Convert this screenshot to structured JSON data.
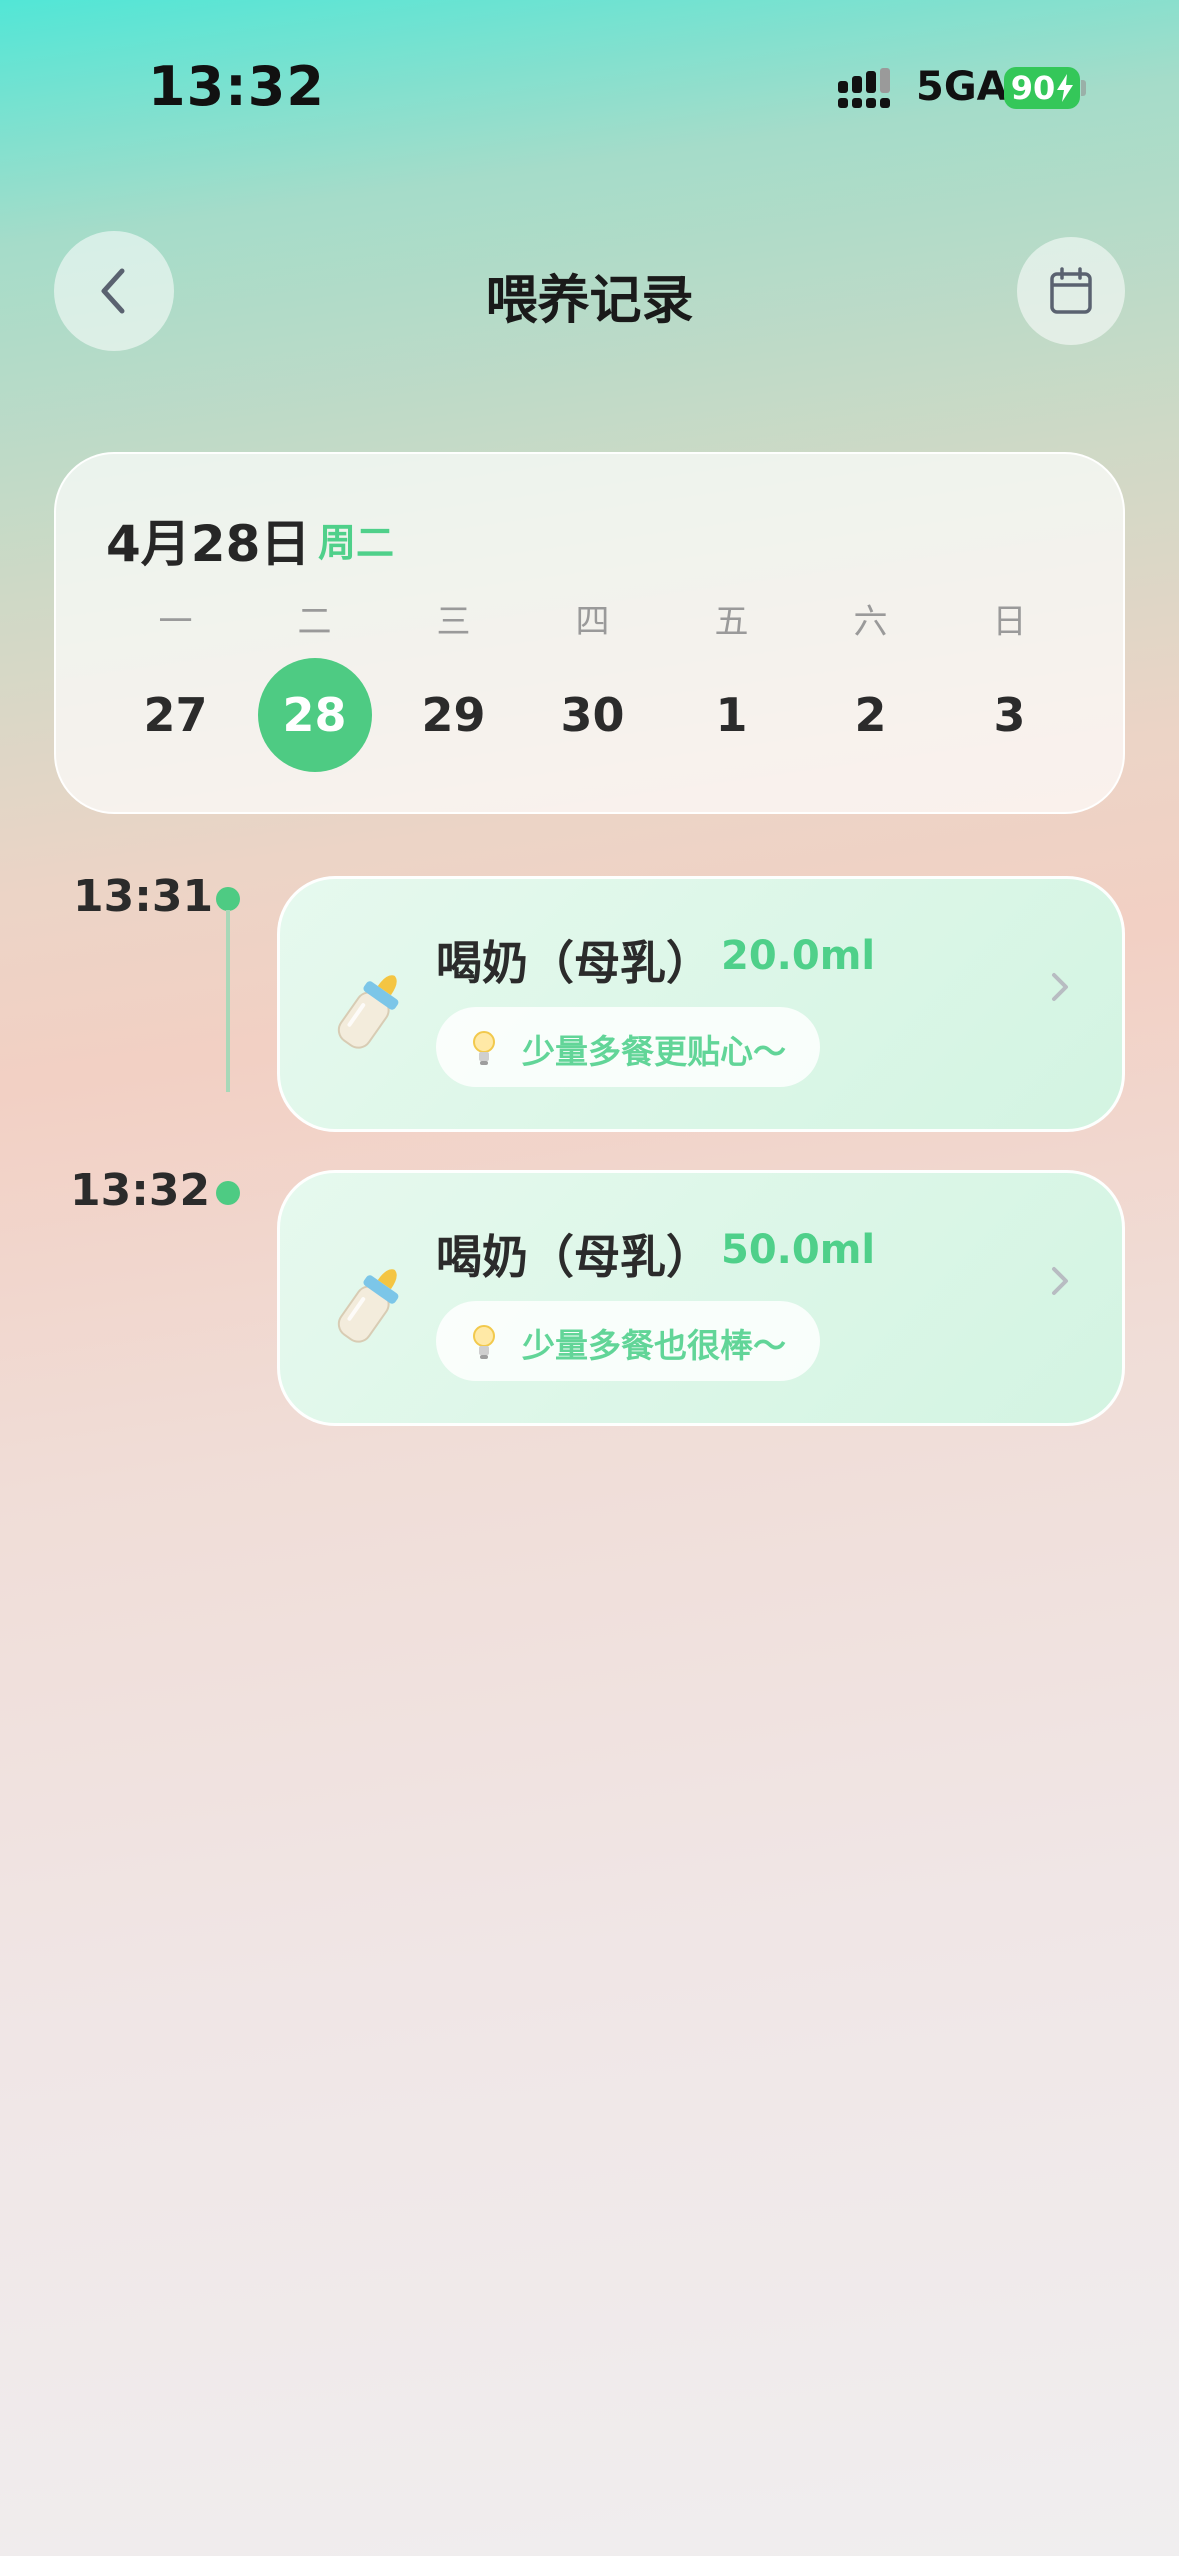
{
  "status_bar": {
    "time": "13:32",
    "network": "5GA",
    "battery": "90"
  },
  "header": {
    "title": "喂养记录",
    "back_icon": "chevron-left-icon",
    "calendar_icon": "calendar-icon"
  },
  "week": {
    "date_title": "4月28日",
    "weekday": "周二",
    "weekdays": [
      "一",
      "二",
      "三",
      "四",
      "五",
      "六",
      "日"
    ],
    "days": [
      "27",
      "28",
      "29",
      "30",
      "1",
      "2",
      "3"
    ],
    "selected_day": "28"
  },
  "colors": {
    "accent": "#4ecb83",
    "accent_text": "#4fd08a",
    "tip_text": "#62d598"
  },
  "records": [
    {
      "time": "13:31",
      "title": "喝奶（母乳）",
      "amount": "20.0ml",
      "tip": "少量多餐更贴心～",
      "icon": "baby-bottle-icon"
    },
    {
      "time": "13:32",
      "title": "喝奶（母乳）",
      "amount": "50.0ml",
      "tip": "少量多餐也很棒～",
      "icon": "baby-bottle-icon"
    }
  ]
}
